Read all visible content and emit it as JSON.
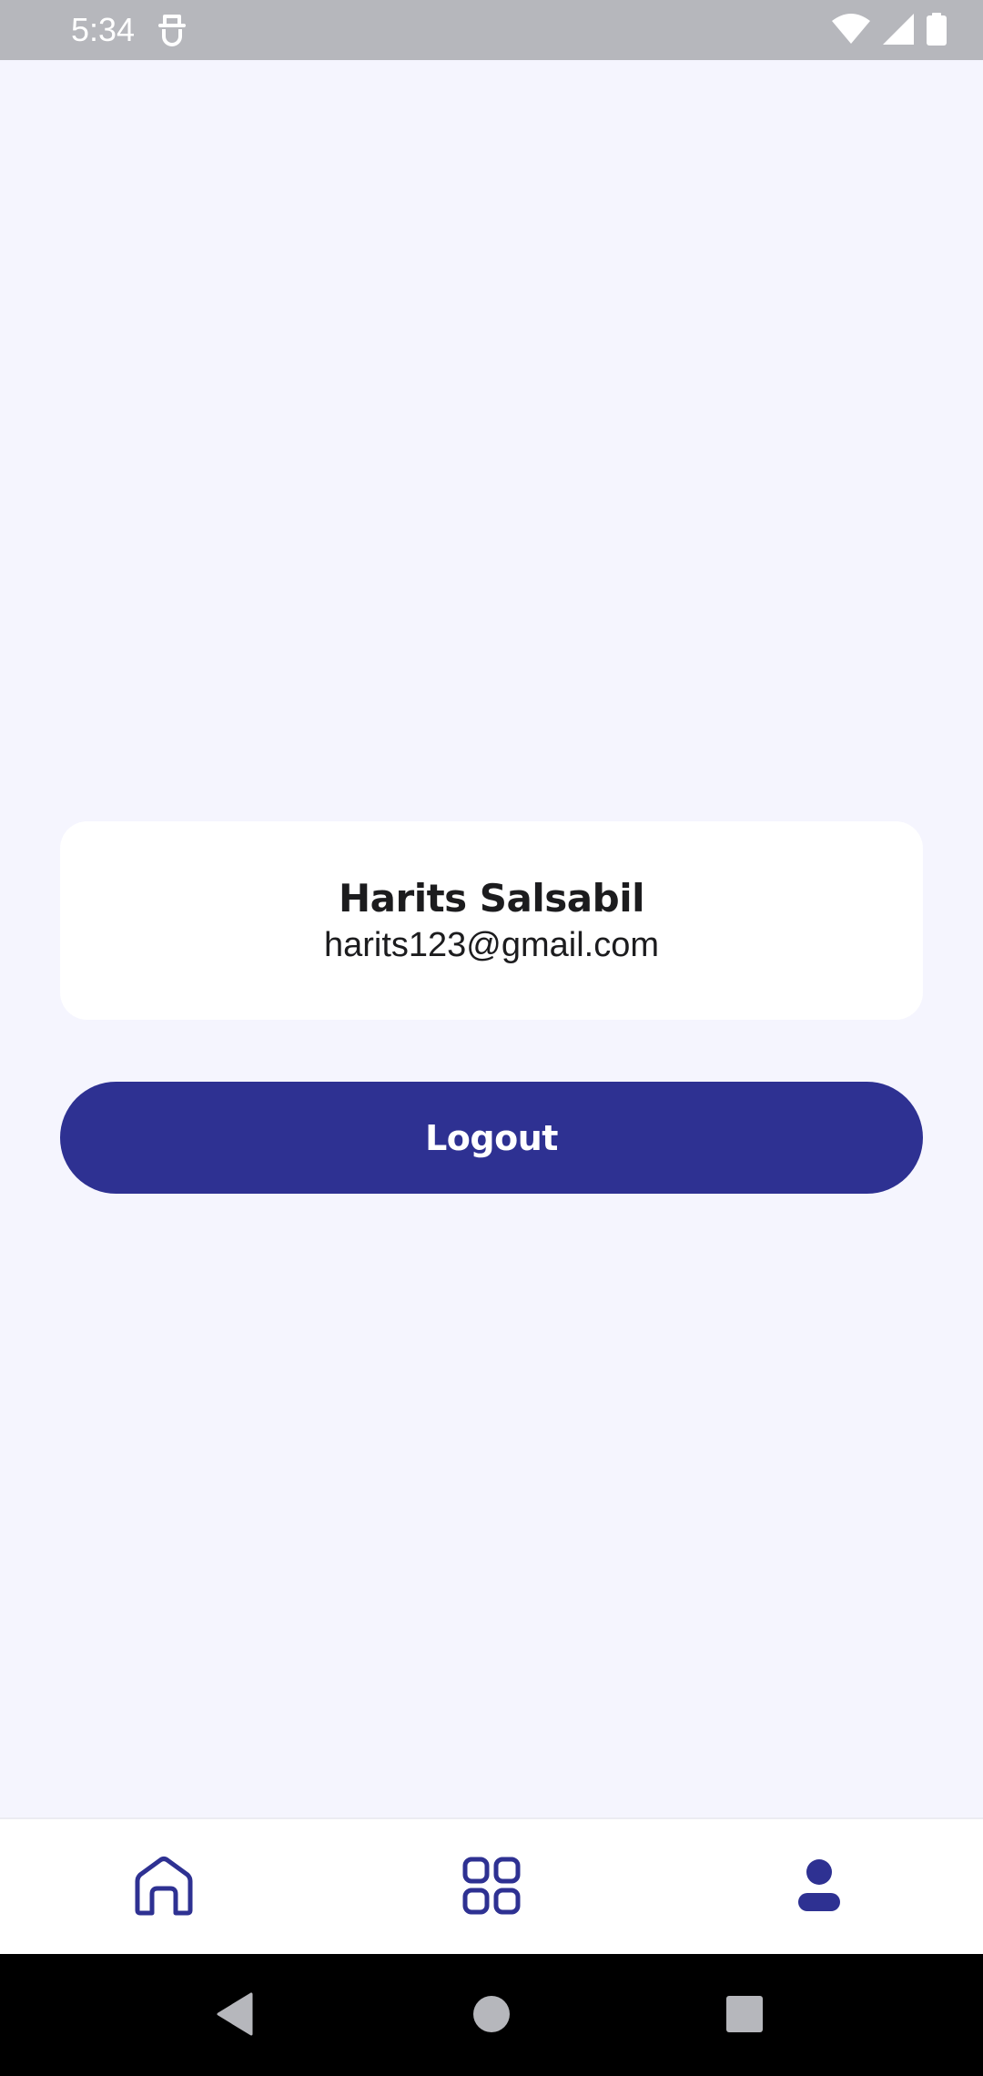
{
  "status_bar": {
    "time": "5:34"
  },
  "profile": {
    "name": "Harits Salsabil",
    "email": "harits123@gmail.com"
  },
  "actions": {
    "logout_label": "Logout"
  },
  "bottom_nav": {
    "items": [
      {
        "icon": "home-icon",
        "active": false
      },
      {
        "icon": "grid-icon",
        "active": false
      },
      {
        "icon": "profile-icon",
        "active": true
      }
    ]
  },
  "colors": {
    "accent": "#2e3192",
    "background": "#f5f5fe",
    "card": "#ffffff",
    "status_bar": "#b6b7bc"
  }
}
